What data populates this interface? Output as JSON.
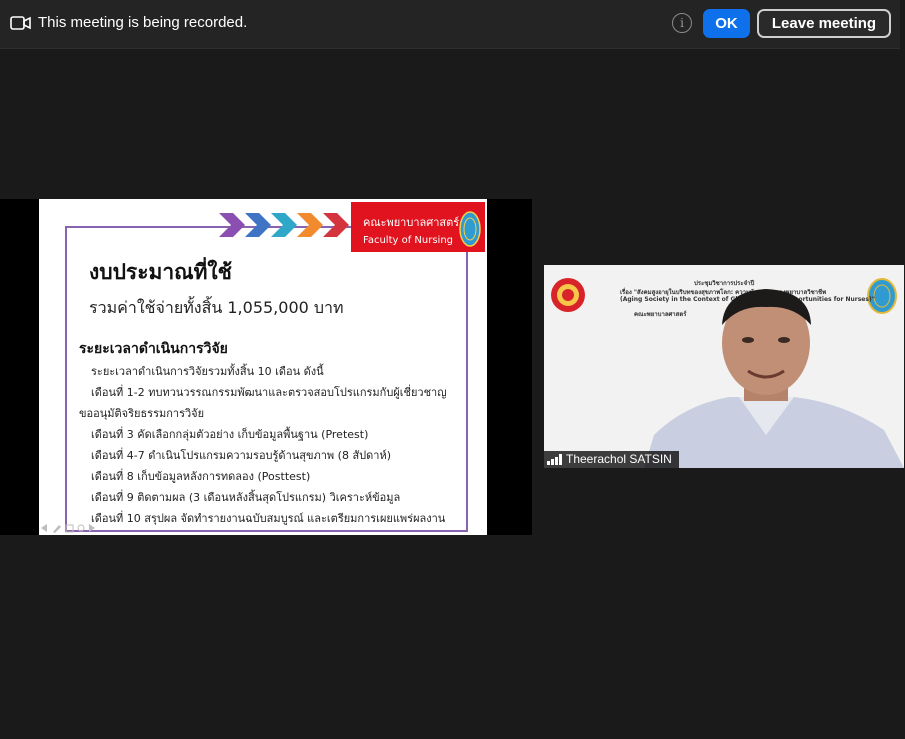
{
  "banner": {
    "message": "This meeting is being recorded.",
    "ok_label": "OK",
    "leave_label": "Leave meeting",
    "info_glyph": "i"
  },
  "slide": {
    "logo_th": "คณะพยาบาลศาสตร์",
    "logo_en": "Faculty of Nursing",
    "title": "งบประมาณที่ใช้",
    "total": "รวมค่าใช้จ่ายทั้งสิ้น 1,055,000 บาท",
    "section_heading": "ระยะเวลาดำเนินการวิจัย",
    "lines": [
      "ระยะเวลาดำเนินการวิจัยรวมทั้งสิ้น 10 เดือน ดังนี้",
      "เดือนที่ 1-2 ทบทวนวรรณกรรมพัฒนาและตรวจสอบโปรแกรมกับผู้เชี่ยวชาญ",
      "ขออนุมัติจริยธรรมการวิจัย",
      "เดือนที่ 3 คัดเลือกกลุ่มตัวอย่าง เก็บข้อมูลพื้นฐาน (Pretest)",
      "เดือนที่ 4-7 ดำเนินโปรแกรมความรอบรู้ด้านสุขภาพ (8 สัปดาห์)",
      "เดือนที่ 8 เก็บข้อมูลหลังการทดลอง (Posttest)",
      "เดือนที่ 9 ติดตามผล (3 เดือนหลังสิ้นสุดโปรแกรม) วิเคราะห์ข้อมูล",
      "เดือนที่ 10 สรุปผล จัดทำรายงานฉบับสมบูรณ์ และเตรียมการเผยแพร่ผลงาน"
    ]
  },
  "video": {
    "banner_line1": "ประชุมวิชาการประจำปี",
    "banner_line2": "เรื่อง \"สังคมสูงอายุในบริบทของสุขภาพโลก: ความท้าทาย...ของพยาบาลวิชาชีพ",
    "banner_line3": "(Aging Society in the Context of Global Health: Ch... ortunities for Nurses)\"",
    "banner_line4": "คณะพยาบาลศาสตร์",
    "participant_name": "Theerachol SATSIN"
  },
  "colors": {
    "ok_blue": "#0e71eb",
    "logo_red": "#e0131f",
    "frame_purple": "#8a63b0",
    "chevrons": [
      "#8a4fb0",
      "#3f74c4",
      "#2ea7c9",
      "#f28a2e",
      "#d3343e"
    ]
  },
  "icons": {
    "recording": "video-camera-icon",
    "info": "info-icon",
    "signal": "signal-strength-icon"
  }
}
